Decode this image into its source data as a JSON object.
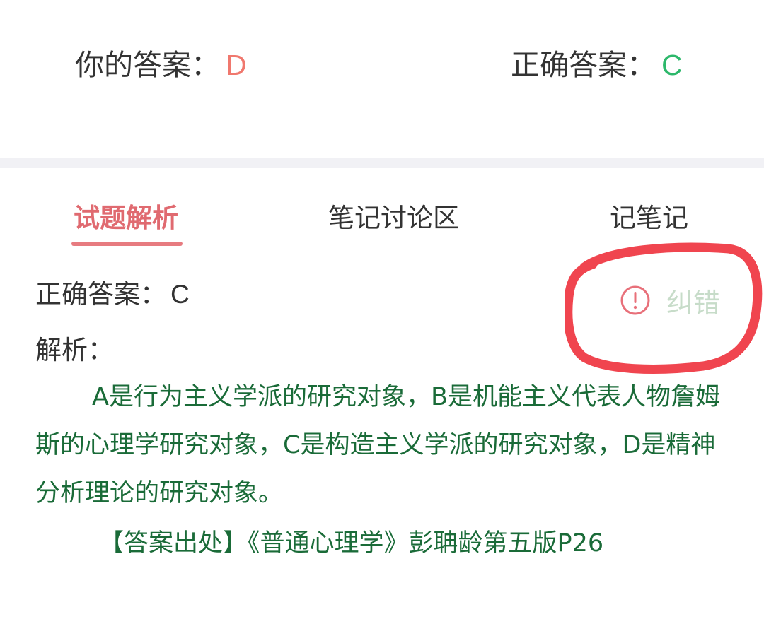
{
  "answers": {
    "your_label": "你的答案：",
    "your_value": "D",
    "correct_label": "正确答案：",
    "correct_value": "C"
  },
  "tabs": [
    {
      "label": "试题解析",
      "active": true
    },
    {
      "label": "笔记讨论区",
      "active": false
    },
    {
      "label": "记笔记",
      "active": false
    }
  ],
  "analysis": {
    "correct_label": "正确答案：",
    "correct_value": "C",
    "label": "解析：",
    "body": "A是行为主义学派的研究对象，B是机能主义代表人物詹姆斯的心理学研究对象，C是构造主义学派的研究对象，D是精神分析理论的研究对象。",
    "source": "【答案出处】《普通心理学》彭聃龄第五版P26"
  },
  "error_report": {
    "label": "纠错",
    "icon": "alert-circle-icon"
  },
  "colors": {
    "wrong": "#f0786e",
    "right": "#2db86b",
    "accent": "#e06a70",
    "analysis_text": "#1a6b38",
    "annotation": "#f0454f"
  }
}
